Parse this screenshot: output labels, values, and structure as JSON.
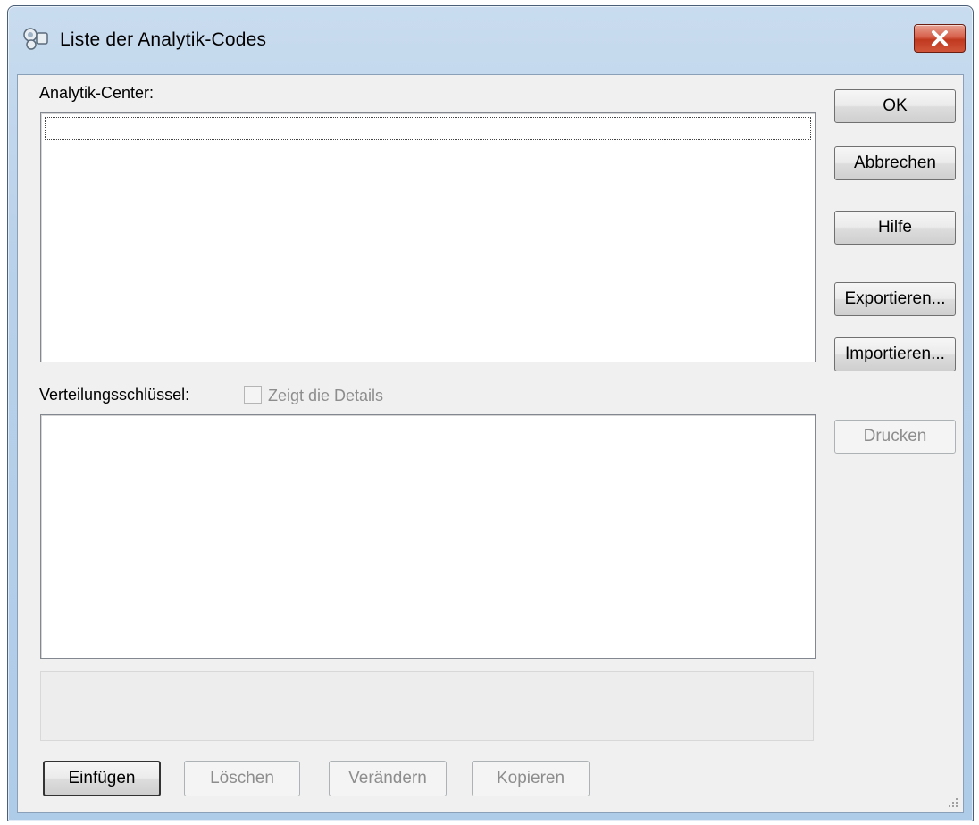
{
  "window": {
    "title": "Liste der Analytik-Codes",
    "icon": "analytics-app-icon",
    "close_icon": "close-icon"
  },
  "analytik_center": {
    "label": "Analytik-Center:"
  },
  "verteilung": {
    "label": "Verteilungsschlüssel:",
    "details_checkbox_label": "Zeigt die Details",
    "details_checked": false
  },
  "side_buttons": {
    "ok": "OK",
    "abbrechen": "Abbrechen",
    "hilfe": "Hilfe",
    "exportieren": "Exportieren...",
    "importieren": "Importieren...",
    "drucken": "Drucken"
  },
  "bottom_buttons": {
    "einfuegen": "Einfügen",
    "loeschen": "Löschen",
    "veraendern": "Verändern",
    "kopieren": "Kopieren"
  },
  "colors": {
    "close_button": "#c8462d",
    "title_bar": "#b9d1ea",
    "disabled_text": "#8d8d8d"
  }
}
